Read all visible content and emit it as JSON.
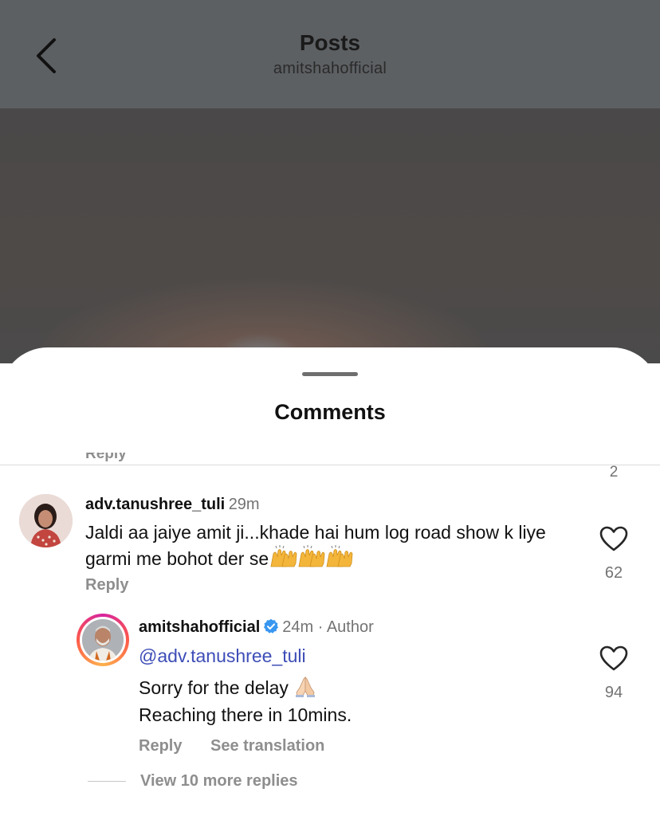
{
  "header": {
    "title": "Posts",
    "subtitle": "amitshahofficial"
  },
  "sheet": {
    "title": "Comments",
    "previous_reply_label": "Reply",
    "previous_like_count": "2"
  },
  "comments": [
    {
      "username": "adv.tanushree_tuli",
      "time": "29m",
      "text": "Jaldi aa jaiye amit ji...khade hai hum log road show k liye garmi me bohot der se",
      "emoji": "raising-hands x3",
      "reply_label": "Reply",
      "like_count": "62"
    }
  ],
  "reply": {
    "username": "amitshahofficial",
    "verified": true,
    "time": "24m",
    "separator": " · ",
    "author_tag": "Author",
    "mention": "@adv.tanushree_tuli",
    "line1": "Sorry for the delay",
    "line1_emoji": "folded-hands",
    "line2": "Reaching there in 10mins.",
    "reply_label": "Reply",
    "translate_label": "See translation",
    "like_count": "94"
  },
  "view_more": "View 10 more replies",
  "colors": {
    "header_bg": "#5d6063",
    "mention": "#3d4db7",
    "verified": "#3897f0",
    "muted_text": "#8e8e8e"
  },
  "icons": {
    "back": "chevron-left-icon",
    "like": "heart-outline-icon",
    "verified": "verified-badge-icon"
  }
}
